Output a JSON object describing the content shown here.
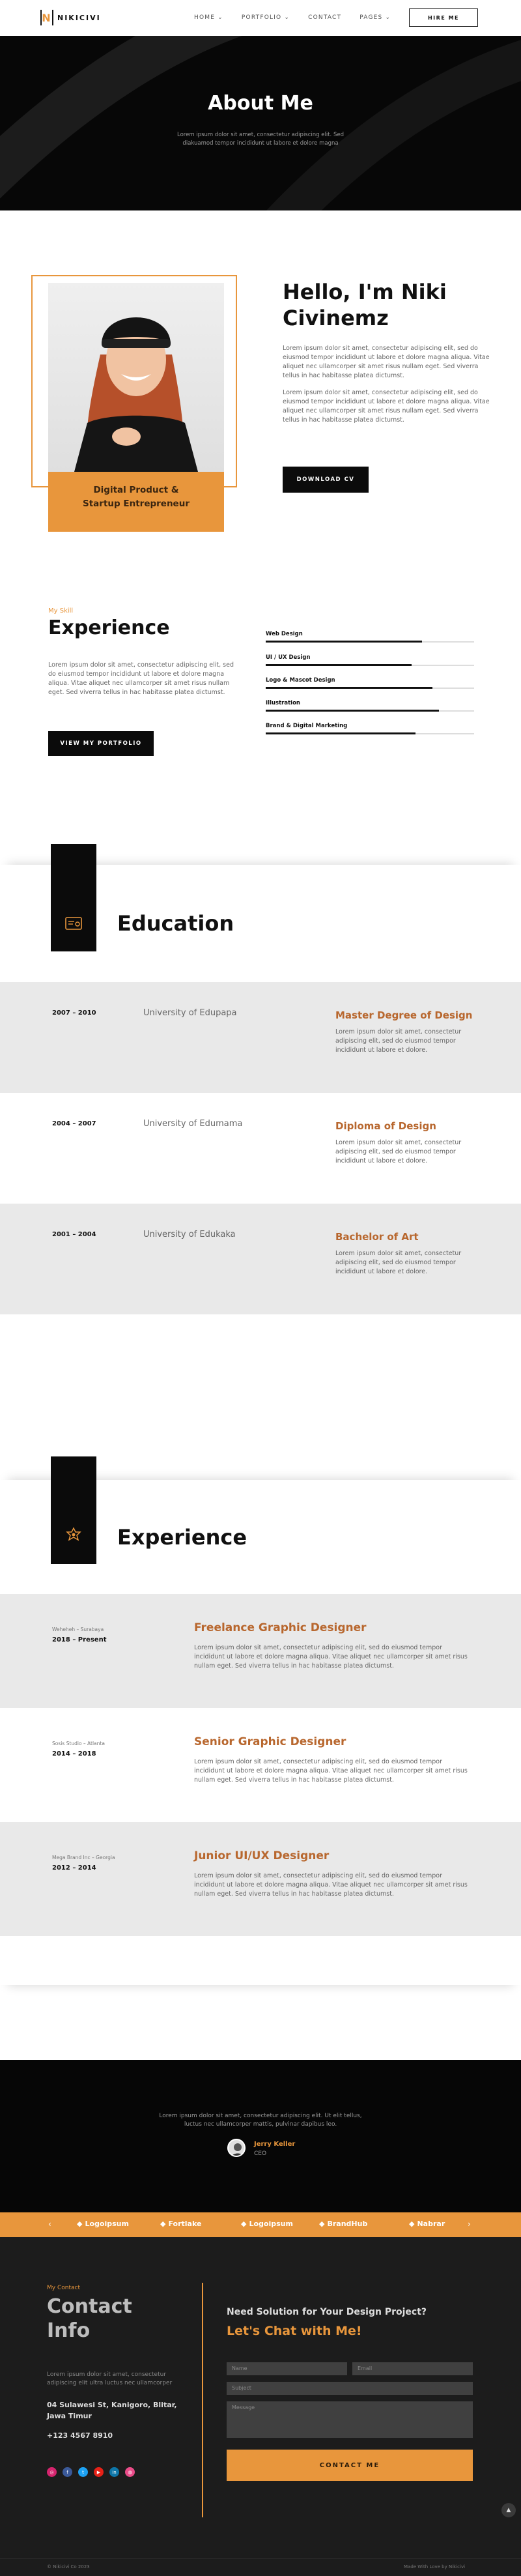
{
  "header": {
    "brand": "NIKICIVI",
    "nav": [
      "HOME",
      "PORTFOLIO",
      "CONTACT",
      "PAGES"
    ],
    "hire": "HIRE ME"
  },
  "hero": {
    "title": "About Me",
    "text": "Lorem ipsum dolor sit amet, consectetur adipiscing elit. Sed diakuamod tempor incididunt ut labore et dolore magna"
  },
  "intro": {
    "caption_line1": "Digital Product &",
    "caption_line2": "Startup Entrepreneur",
    "heading_line1": "Hello, I'm Niki",
    "heading_line2": "Civinemz",
    "p1": "Lorem ipsum dolor sit amet, consectetur adipiscing elit, sed do eiusmod tempor incididunt ut labore et dolore magna aliqua. Vitae aliquet nec ullamcorper sit amet risus nullam eget. Sed viverra tellus in hac habitasse platea dictumst.",
    "p2": "Lorem ipsum dolor sit amet, consectetur adipiscing elit, sed do eiusmod tempor incididunt ut labore et dolore magna aliqua. Vitae aliquet nec ullamcorper sit amet risus nullam eget. Sed viverra tellus in hac habitasse platea dictumst.",
    "download": "DOWNLOAD CV"
  },
  "skills": {
    "kicker": "My Skill",
    "title": "Experience",
    "text": "Lorem ipsum dolor sit amet, consectetur adipiscing elit, sed do eiusmod tempor incididunt ut labore et dolore magna aliqua. Vitae aliquet nec ullamcorper sit amet risus nullam eget. Sed viverra tellus in hac habitasse platea dictumst.",
    "button": "VIEW MY PORTFOLIO",
    "items": [
      {
        "label": "Web Design",
        "level": 0.75
      },
      {
        "label": "UI / UX Design",
        "level": 0.7
      },
      {
        "label": "Logo & Mascot Design",
        "level": 0.8
      },
      {
        "label": "Illustration",
        "level": 0.83
      },
      {
        "label": "Brand & Digital Marketing",
        "level": 0.72
      }
    ]
  },
  "education": {
    "title": "Education",
    "rows": [
      {
        "years": "2007 – 2010",
        "school": "University of Edupapa",
        "degree": "Master Degree of Design",
        "text": "Lorem ipsum dolor sit amet, consectetur adipiscing elit, sed do eiusmod tempor incididunt ut labore et dolore."
      },
      {
        "years": "2004 – 2007",
        "school": "University of Edumama",
        "degree": "Diploma of Design",
        "text": "Lorem ipsum dolor sit amet, consectetur adipiscing elit, sed do eiusmod tempor incididunt ut labore et dolore."
      },
      {
        "years": "2001 – 2004",
        "school": "University of Edukaka",
        "degree": "Bachelor of Art",
        "text": "Lorem ipsum dolor sit amet, consectetur adipiscing elit, sed do eiusmod tempor incididunt ut labore et dolore."
      }
    ]
  },
  "experience": {
    "title": "Experience",
    "rows": [
      {
        "place": "Weheheh – Surabaya",
        "years": "2018 – Present",
        "role": "Freelance Graphic Designer",
        "text": "Lorem ipsum dolor sit amet, consectetur adipiscing elit, sed do eiusmod tempor incididunt ut labore et dolore magna aliqua. Vitae aliquet nec ullamcorper sit amet risus nullam eget. Sed viverra tellus in hac habitasse platea dictumst."
      },
      {
        "place": "Sosis Studio – Atlanta",
        "years": "2014 – 2018",
        "role": "Senior Graphic Designer",
        "text": "Lorem ipsum dolor sit amet, consectetur adipiscing elit, sed do eiusmod tempor incididunt ut labore et dolore magna aliqua. Vitae aliquet nec ullamcorper sit amet risus nullam eget. Sed viverra tellus in hac habitasse platea dictumst."
      },
      {
        "place": "Mega Brand Inc – Georgia",
        "years": "2012 – 2014",
        "role": "Junior UI/UX Designer",
        "text": "Lorem ipsum dolor sit amet, consectetur adipiscing elit, sed do eiusmod tempor incididunt ut labore et dolore magna aliqua. Vitae aliquet nec ullamcorper sit amet risus nullam eget. Sed viverra tellus in hac habitasse platea dictumst."
      }
    ]
  },
  "testimonial": {
    "quote": "Lorem ipsum dolor sit amet, consectetur adipiscing elit. Ut elit tellus, luctus nec ullamcorper mattis, pulvinar dapibus leo.",
    "name": "Jerry Keller",
    "role": "CEO"
  },
  "brands": [
    "Logoipsum",
    "Fortlake",
    "Logoipsum",
    "BrandHub",
    "Nabrar"
  ],
  "contact": {
    "kicker": "My Contact",
    "title_line1": "Contact",
    "title_line2": "Info",
    "text": "Lorem ipsum dolor sit amet, consectetur adipiscing elit ultra luctus nec ullamcorper",
    "address": "04 Sulawesi St, Kanigoro, Blitar, Jawa Timur",
    "phone": "+123 4567 8910",
    "need": "Need Solution for Your Design Project?",
    "chat": "Let's Chat with Me!",
    "name_ph": "Name",
    "email_ph": "Email",
    "subject_ph": "Subject",
    "message_ph": "Message",
    "submit": "CONTACT ME",
    "copyright": "© Nikicivi Co 2023",
    "credit": "Made With Love by Nikicivi"
  },
  "colors": {
    "accent": "#e8963c",
    "dark": "#0b0b0b"
  }
}
